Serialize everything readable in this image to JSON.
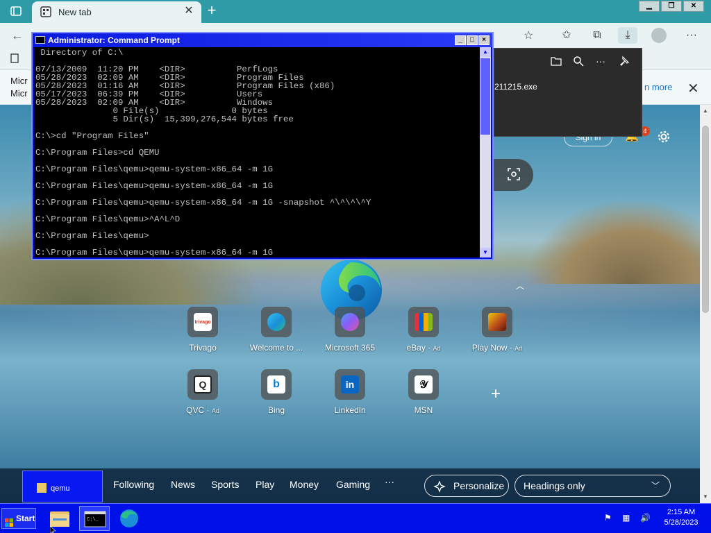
{
  "browser": {
    "tab": {
      "title": "New tab"
    },
    "toolbar": {
      "profile_color": "#b9c4c6"
    },
    "infobar": {
      "lines": [
        "Micr",
        "Micr"
      ],
      "link": "n more",
      "download_file": "211215.exe"
    }
  },
  "newtab": {
    "signin_label": "Sign in",
    "notification_count": "4",
    "quick_links_row1": [
      {
        "label": "Trivago",
        "ad": "",
        "icon": "trivago-icon",
        "color": "#ffffff"
      },
      {
        "label": "Welcome to ...",
        "ad": "",
        "icon": "edge-icon",
        "color": "#1f8fd6"
      },
      {
        "label": "Microsoft 365",
        "ad": "",
        "icon": "copilot-icon",
        "color": "#6c5ce7"
      },
      {
        "label": "eBay",
        "ad": "Ad",
        "icon": "ebay-bag-icon",
        "color": "#f5af02"
      },
      {
        "label": "Play Now",
        "ad": "Ad",
        "icon": "game-icon",
        "color": "#b5451c"
      }
    ],
    "quick_links_row2": [
      {
        "label": "QVC",
        "ad": "Ad",
        "icon": "qvc-icon",
        "color": "#ffffff"
      },
      {
        "label": "Bing",
        "ad": "",
        "icon": "bing-icon",
        "color": "#ffffff"
      },
      {
        "label": "LinkedIn",
        "ad": "",
        "icon": "linkedin-icon",
        "color": "#0a66c2"
      },
      {
        "label": "MSN",
        "ad": "",
        "icon": "msn-icon",
        "color": "#ffffff"
      }
    ],
    "feed_nav": [
      "Following",
      "News",
      "Sports",
      "Play",
      "Money",
      "Gaming"
    ],
    "feed_more": "···",
    "personalize_label": "Personalize",
    "layout_select": "Headings only"
  },
  "cmd": {
    "title": "Administrator: Command Prompt",
    "lines": [
      " Directory of C:\\",
      "",
      "07/13/2009  11:20 PM    <DIR>          PerfLogs",
      "05/28/2023  02:09 AM    <DIR>          Program Files",
      "05/28/2023  01:16 AM    <DIR>          Program Files (x86)",
      "05/17/2023  06:39 PM    <DIR>          Users",
      "05/28/2023  02:09 AM    <DIR>          Windows",
      "               0 File(s)              0 bytes",
      "               5 Dir(s)  15,399,276,544 bytes free",
      "",
      "C:\\>cd \"Program Files\"",
      "",
      "C:\\Program Files>cd QEMU",
      "",
      "C:\\Program Files\\qemu>qemu-system-x86_64 -m 1G",
      "",
      "C:\\Program Files\\qemu>qemu-system-x86_64 -m 1G",
      "",
      "C:\\Program Files\\qemu>qemu-system-x86_64 -m 1G -snapshot ^\\^\\^\\^Y",
      "",
      "C:\\Program Files\\qemu>^A^L^D",
      "",
      "C:\\Program Files\\qemu>",
      "",
      "C:\\Program Files\\qemu>qemu-system-x86_64 -m 1G"
    ]
  },
  "taskbar": {
    "start_label": "Start",
    "qemu_window_label": "qemu",
    "clock_time": "2:15 AM",
    "clock_date": "5/28/2023",
    "accent": "#0010e8"
  }
}
